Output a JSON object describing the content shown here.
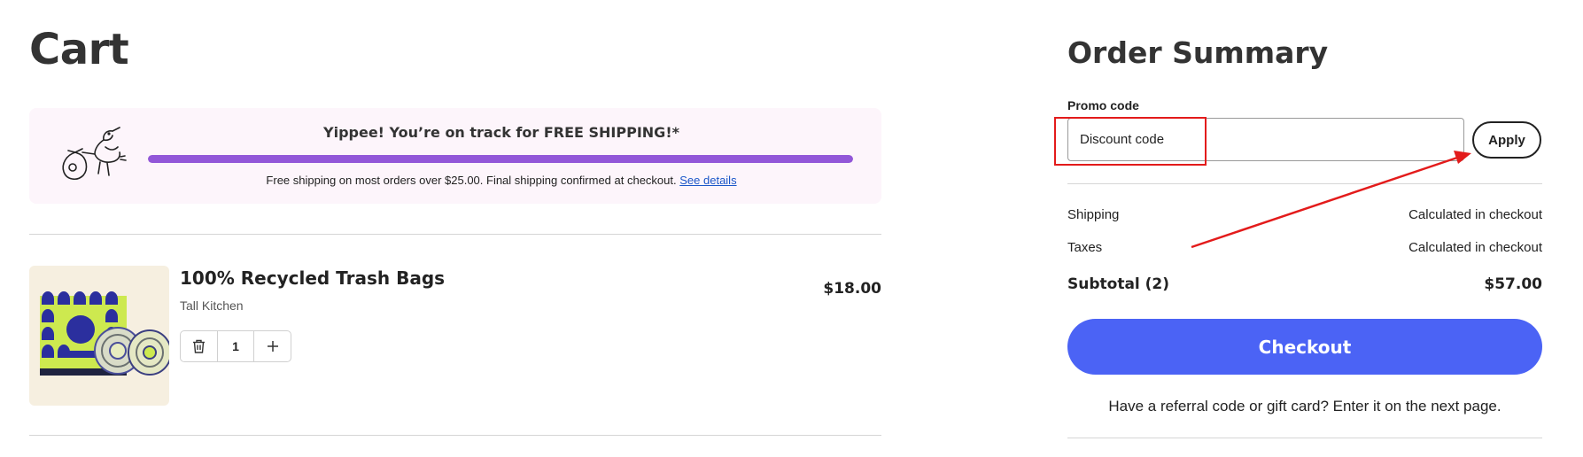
{
  "cart": {
    "title": "Cart",
    "shipping_banner": {
      "headline": "Yippee! You’re on track for FREE SHIPPING!*",
      "progress": 1.0,
      "note": "Free shipping on most orders over $25.00. Final shipping confirmed at checkout.",
      "details_link": "See details",
      "icon": "stork-icon"
    },
    "items": [
      {
        "name": "100% Recycled Trash Bags",
        "variant": "Tall Kitchen",
        "price": "$18.00",
        "quantity": "1",
        "image": "trash-bags-product-image"
      }
    ]
  },
  "summary": {
    "title": "Order Summary",
    "promo_label": "Promo code",
    "promo_placeholder": "Discount code",
    "apply_label": "Apply",
    "shipping_label": "Shipping",
    "shipping_value": "Calculated in checkout",
    "taxes_label": "Taxes",
    "taxes_value": "Calculated in checkout",
    "subtotal_label": "Subtotal (2)",
    "subtotal_value": "$57.00",
    "checkout_label": "Checkout",
    "referral_text": "Have a referral code or gift card? Enter it on the next page."
  },
  "colors": {
    "accent_blue": "#4b63f5",
    "progress_purple": "#9257d8",
    "banner_bg": "#fdf5fb",
    "annotation_red": "#e31b1b"
  }
}
